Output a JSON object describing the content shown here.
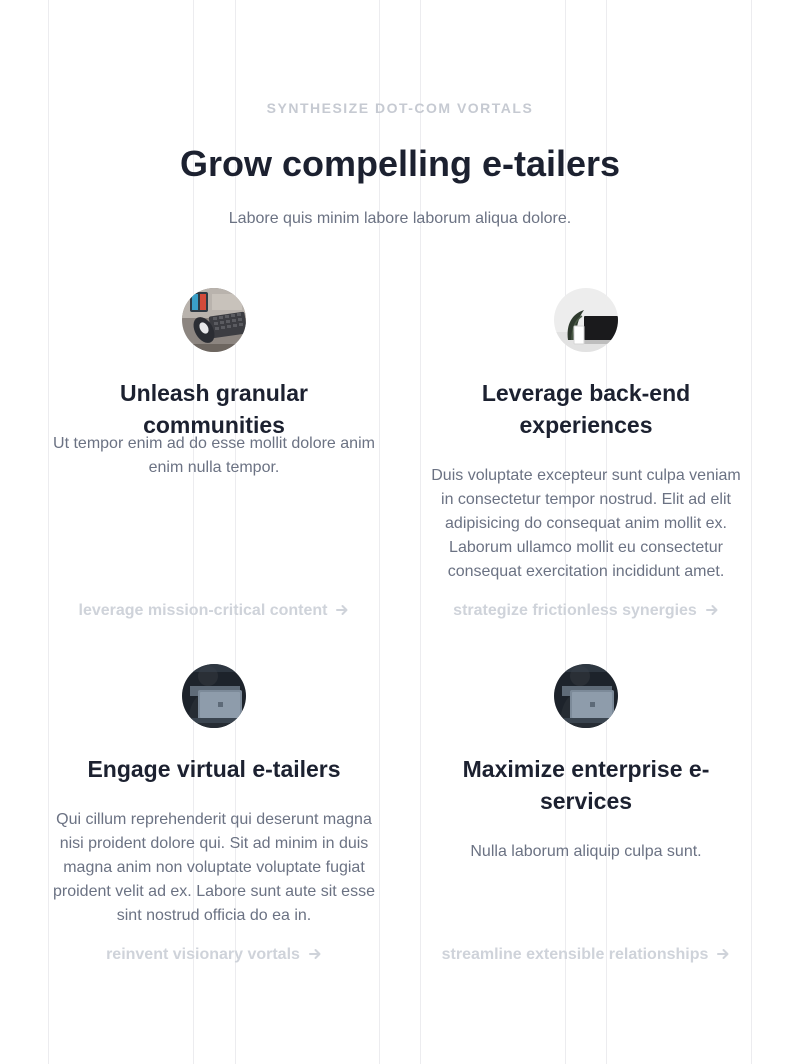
{
  "header": {
    "eyebrow": "SYNTHESIZE DOT-COM VORTALS",
    "title": "Grow compelling e-tailers",
    "subtitle": "Labore quis minim labore laborum aliqua dolore."
  },
  "features": [
    {
      "avatar_icon": "keyboard-desk-photo",
      "title": "Unleash granular communities",
      "description": "Ut tempor enim ad do esse mollit dolore anim enim nulla tempor.",
      "link": "leverage mission-critical content"
    },
    {
      "avatar_icon": "laptop-plant-photo",
      "title": "Leverage back-end experiences",
      "description": "Duis voluptate excepteur sunt culpa veniam in consectetur tempor nostrud. Elit ad elit adipisicing do consequat anim mollit ex. Laborum ullamco mollit eu consectetur consequat exercitation incididunt amet.",
      "link": "strategize frictionless synergies"
    },
    {
      "avatar_icon": "person-laptop-photo",
      "title": "Engage virtual e-tailers",
      "description": "Qui cillum reprehenderit qui deserunt magna nisi proident dolore qui. Sit ad minim in duis magna anim non voluptate voluptate fugiat proident velit ad ex. Labore sunt aute sit esse sint nostrud officia do ea in.",
      "link": "reinvent visionary vortals"
    },
    {
      "avatar_icon": "person-laptop-photo",
      "title": "Maximize enterprise e-services",
      "description": "Nulla laborum aliquip culpa sunt.",
      "link": "streamline extensible relationships"
    }
  ],
  "colors": {
    "heading": "#1c2130",
    "body_text": "#6b7283",
    "eyebrow": "#c6cad2",
    "link": "#cfd3da",
    "grid_line": "#ececef"
  }
}
